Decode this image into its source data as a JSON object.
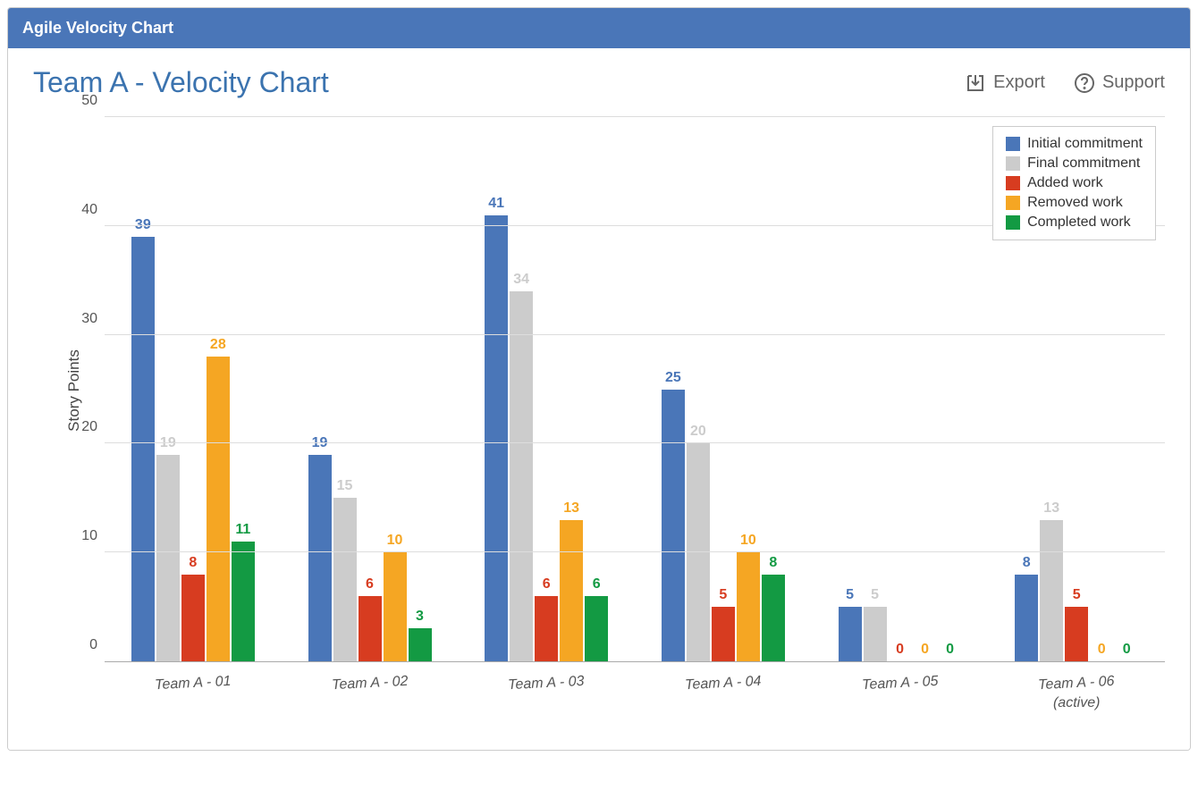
{
  "panel_header": "Agile Velocity Chart",
  "chart_title": "Team A - Velocity Chart",
  "actions": {
    "export_label": "Export",
    "support_label": "Support"
  },
  "y_axis_label": "Story Points",
  "chart_data": {
    "type": "bar",
    "ylabel": "Story Points",
    "ylim": [
      0,
      50
    ],
    "yticks": [
      0,
      10,
      20,
      30,
      40,
      50
    ],
    "categories": [
      "Team A - 01",
      "Team A - 02",
      "Team A - 03",
      "Team A - 04",
      "Team A - 05",
      "Team A - 06 (active)"
    ],
    "series": [
      {
        "name": "Initial commitment",
        "color": "#4a76b8",
        "values": [
          39,
          19,
          41,
          25,
          5,
          8
        ]
      },
      {
        "name": "Final commitment",
        "color": "#cccccc",
        "values": [
          19,
          15,
          34,
          20,
          5,
          13
        ]
      },
      {
        "name": "Added work",
        "color": "#d73c20",
        "values": [
          8,
          6,
          6,
          5,
          0,
          5
        ]
      },
      {
        "name": "Removed work",
        "color": "#f5a623",
        "values": [
          28,
          10,
          13,
          10,
          0,
          0
        ]
      },
      {
        "name": "Completed work",
        "color": "#139a43",
        "values": [
          11,
          3,
          6,
          8,
          0,
          0
        ]
      }
    ]
  }
}
